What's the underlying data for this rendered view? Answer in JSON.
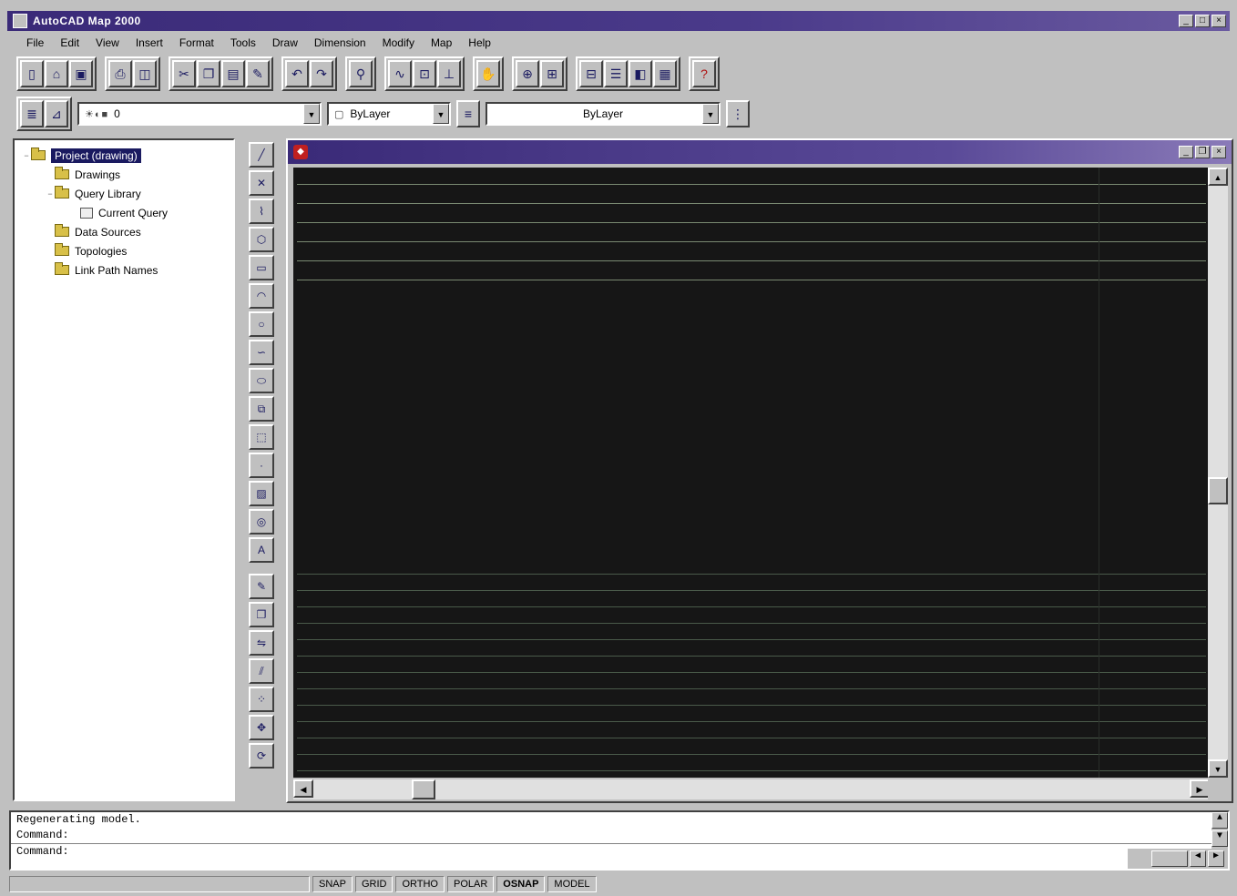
{
  "window": {
    "title": "AutoCAD Map 2000"
  },
  "menu": [
    "File",
    "Edit",
    "View",
    "Insert",
    "Format",
    "Tools",
    "Draw",
    "Dimension",
    "Modify",
    "Map",
    "Help"
  ],
  "toolbar2": {
    "layer": "0",
    "linetype": "ByLayer",
    "color": "ByLayer"
  },
  "project": {
    "root": "Project (drawing)",
    "items": [
      {
        "label": "Drawings",
        "indent": 1
      },
      {
        "label": "Query Library",
        "indent": 1
      },
      {
        "label": "Current Query",
        "indent": 2
      },
      {
        "label": "Data Sources",
        "indent": 1
      },
      {
        "label": "Topologies",
        "indent": 1
      },
      {
        "label": "Link Path Names",
        "indent": 1
      }
    ]
  },
  "command": {
    "history": "Regenerating model.",
    "line2": "Command:",
    "line3": "Command:"
  },
  "status": {
    "coords": "",
    "snap": "SNAP",
    "grid": "GRID",
    "ortho": "ORTHO",
    "polar": "POLAR",
    "osnap": "OSNAP",
    "model": "MODEL"
  }
}
